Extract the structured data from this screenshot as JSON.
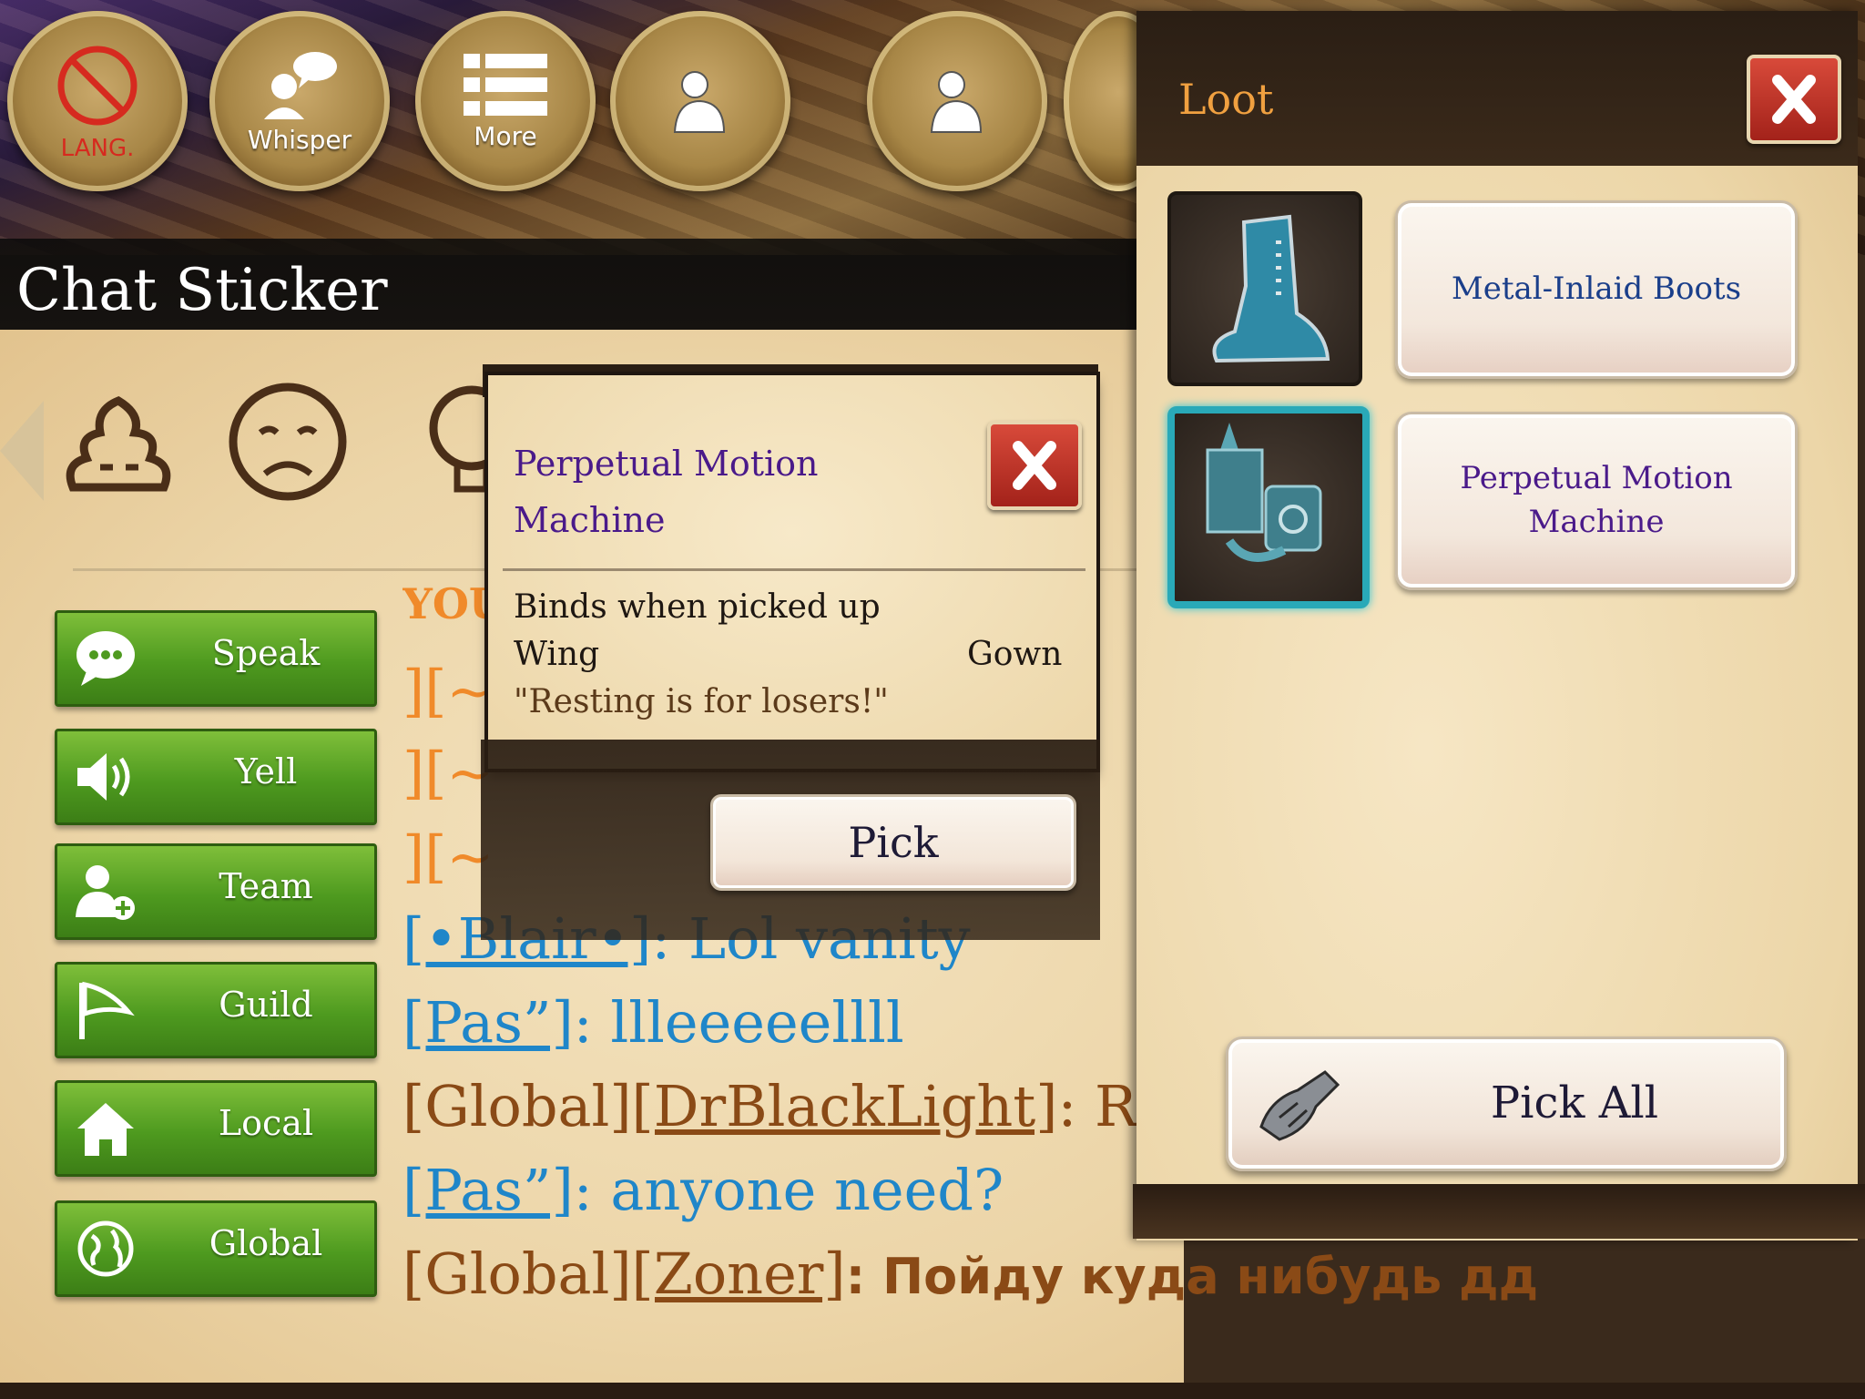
{
  "top_buttons": [
    {
      "label": "LANG.",
      "icon": "no-lang-icon"
    },
    {
      "label": "Whisper",
      "icon": "whisper-icon"
    },
    {
      "label": "More",
      "icon": "list-icon"
    },
    {
      "label": "",
      "icon": "person-icon"
    },
    {
      "label": "",
      "icon": "person-icon"
    }
  ],
  "chat": {
    "title": "Chat Sticker",
    "channels": [
      {
        "label": "Speak",
        "icon": "speech-bubble-icon"
      },
      {
        "label": "Yell",
        "icon": "speaker-icon"
      },
      {
        "label": "Team",
        "icon": "add-user-icon"
      },
      {
        "label": "Guild",
        "icon": "flag-icon"
      },
      {
        "label": "Local",
        "icon": "home-icon"
      },
      {
        "label": "Global",
        "icon": "globe-icon"
      }
    ],
    "messages": [
      {
        "prefix": "[•Blair•]",
        "text": ": Lol vanity",
        "color": "#1f86c9"
      },
      {
        "prefix": "[Pas”]",
        "text": ": llleeeeellll",
        "color": "#1f86c9"
      },
      {
        "channel": "[Global]",
        "prefix": "[DrBlackLight]",
        "text": ": Rave",
        "color": "#8a4a16"
      },
      {
        "prefix": "[Pas”]",
        "text": ": anyone need?",
        "color": "#1f86c9"
      },
      {
        "channel": "[Global]",
        "prefix": "[Zoner]",
        "text": ": Пойду куда нибудь дд",
        "color": "#8a4a16"
      }
    ],
    "partial_texts": {
      "you": "YOU",
      "row1": "][~",
      "row2": "][~",
      "row3": "][~"
    }
  },
  "loot": {
    "title": "Loot",
    "items": [
      {
        "name": "Metal-Inlaid Boots",
        "icon": "boots-icon"
      },
      {
        "name": "Perpetual Motion\nMachine",
        "icon": "machine-icon"
      }
    ],
    "pick_all_label": "Pick All"
  },
  "tooltip": {
    "title_line1": "Perpetual Motion",
    "title_line2": "Machine",
    "binds": "Binds when picked up",
    "slot": "Wing",
    "type": "Gown",
    "flavor": "\"Resting is for losers!\"",
    "pick_label": "Pick"
  },
  "colors": {
    "accent_green": "#4e9a1f",
    "loot_title": "#f0a040",
    "item_blue": "#1a3e8a",
    "item_purple": "#4a1a8a",
    "selected_cyan": "#29a9b8"
  }
}
